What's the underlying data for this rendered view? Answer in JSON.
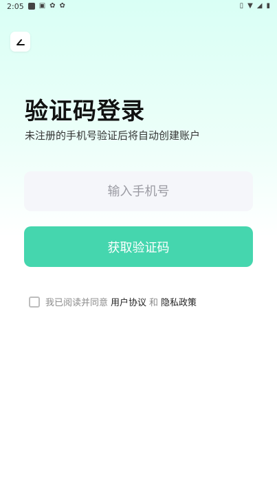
{
  "status_bar": {
    "time": "2:05"
  },
  "header": {
    "back_icon": "back-arrow-icon"
  },
  "main": {
    "title": "验证码登录",
    "subtitle": "未注册的手机号验证后将自动创建账户",
    "phone_input": {
      "value": "",
      "placeholder": "输入手机号"
    },
    "get_code_label": "获取验证码"
  },
  "agreement": {
    "checked": false,
    "prefix": "我已阅读并同意",
    "user_agreement": "用户协议",
    "and": "和",
    "privacy_policy": "隐私政策"
  },
  "colors": {
    "accent": "#45D6AE",
    "input_bg": "#F5F6FA",
    "gradient_top": "#D9FFF5"
  }
}
